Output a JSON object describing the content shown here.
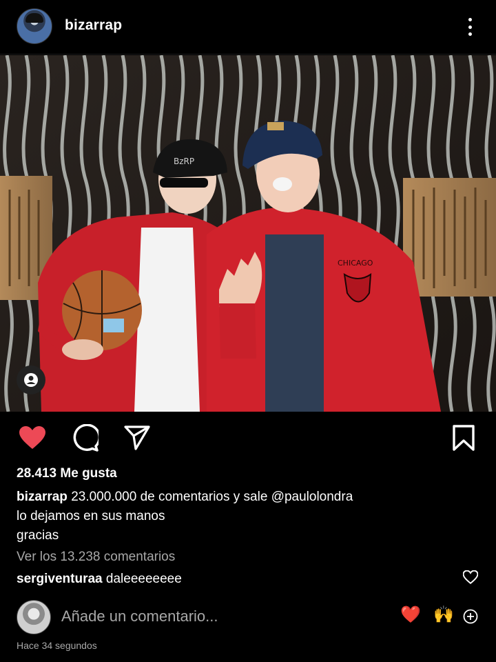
{
  "header": {
    "username": "bizarrap",
    "avatar_icon": "profile-avatar",
    "more_icon": "vertical-dots-icon"
  },
  "post": {
    "image_alt": "Two men in red Chicago Bulls jackets holding a basketball",
    "tag_icon": "user-tag-icon",
    "actions": {
      "like_icon": "heart-filled-icon",
      "comment_icon": "comment-bubble-icon",
      "share_icon": "paper-plane-icon",
      "save_icon": "bookmark-icon",
      "like_color": "#ed4956"
    },
    "likes_text": "28.413 Me gusta",
    "caption": {
      "username": "bizarrap",
      "line1": "23.000.000 de comentarios y sale @paulolondra",
      "line2": "lo dejamos en sus manos",
      "line3": "gracias"
    },
    "view_comments": "Ver los 13.238 comentarios",
    "top_comment": {
      "username": "sergiventuraa",
      "text": "daleeeeeeee"
    },
    "add_comment": {
      "placeholder": "Añade un comentario...",
      "emoji_1": "❤️",
      "emoji_2": "🙌"
    },
    "timestamp": "Hace 34 segundos"
  }
}
